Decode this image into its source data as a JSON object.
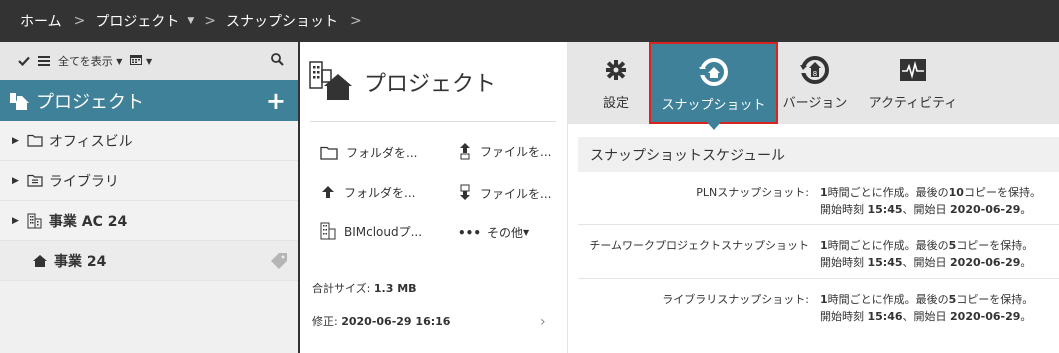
{
  "breadcrumb": {
    "home": "ホーム",
    "sep": ">",
    "project": "プロジェクト",
    "snapshot": "スナップショット"
  },
  "left": {
    "toolbar": {
      "show_all": "全てを表示"
    },
    "header": {
      "title": "プロジェクト",
      "add": "+"
    },
    "tree": [
      {
        "label": "オフィスビル",
        "icon": "folder-icon"
      },
      {
        "label": "ライブラリ",
        "icon": "library-icon"
      },
      {
        "label": "事業 AC 24",
        "icon": "building-icon"
      },
      {
        "label": "事業 24",
        "icon": "project-house-icon"
      }
    ]
  },
  "middle": {
    "title": "プロジェクト",
    "actions": {
      "new_folder": "フォルダを...",
      "new_file": "ファイルを...",
      "upload_folder": "フォルダを...",
      "download_file": "ファイルを...",
      "bimcloud": "BIMcloudプ...",
      "more_dots": "•••",
      "more": "その他"
    },
    "stats": {
      "size_label": "合計サイズ:",
      "size_value": "1.3 MB",
      "modified_label": "修正:",
      "modified_value": "2020-06-29 16:16"
    },
    "chevron": "›"
  },
  "tabs": [
    {
      "label": "設定",
      "icon": "gear-icon"
    },
    {
      "label": "スナップショット",
      "icon": "snapshot-icon",
      "active": true
    },
    {
      "label": "バージョン",
      "icon": "version-icon"
    },
    {
      "label": "アクティビティ",
      "icon": "activity-icon"
    }
  ],
  "schedule": {
    "title": "スナップショットスケジュール",
    "rows": [
      {
        "label": "PLNスナップショット:",
        "line1_a": "1",
        "line1_b": "時間ごとに作成。最後の",
        "line1_c": "10",
        "line1_d": "コピーを保持。",
        "line2_a": "開始時刻 ",
        "line2_b": "15:45",
        "line2_c": "、開始日 ",
        "line2_d": "2020-06-29",
        "line2_e": "。"
      },
      {
        "label": "チームワークプロジェクトスナップショット",
        "line1_a": "1",
        "line1_b": "時間ごとに作成。最後の",
        "line1_c": "5",
        "line1_d": "コピーを保持。",
        "line2_a": "開始時刻 ",
        "line2_b": "15:45",
        "line2_c": "、開始日 ",
        "line2_d": "2020-06-29",
        "line2_e": "。"
      },
      {
        "label": "ライブラリスナップショット:",
        "line1_a": "1",
        "line1_b": "時間ごとに作成。最後の",
        "line1_c": "5",
        "line1_d": "コピーを保持。",
        "line2_a": "開始時刻 ",
        "line2_b": "15:46",
        "line2_c": "、開始日 ",
        "line2_d": "2020-06-29",
        "line2_e": "。"
      }
    ]
  },
  "colors": {
    "accent": "#3f8199",
    "highlight_border": "#d9231e",
    "topbar": "#333333"
  }
}
